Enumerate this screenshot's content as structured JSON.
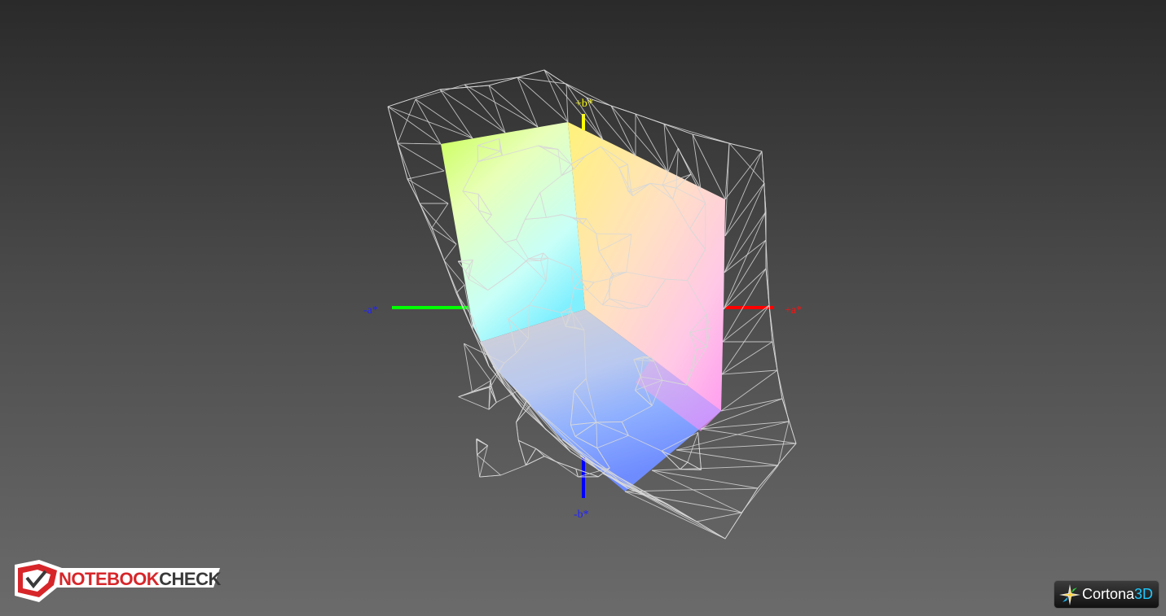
{
  "axes": {
    "plus_b": "+b*",
    "minus_b": "-b*",
    "minus_a": "-a*",
    "plus_a": "+a*"
  },
  "colors": {
    "background_top": "#2a2a2a",
    "background_bottom": "#6b6b6b",
    "axis_plus_a": "#ff0000",
    "axis_minus_a": "#00ff00",
    "axis_minus_b": "#0000ff",
    "axis_plus_b": "#ffff00",
    "wireframe": "#d8d8d8"
  },
  "branding": {
    "left_logo_part1": "NOTEBOOK",
    "left_logo_part2": "CHECK",
    "right_logo_part1": "Cortona",
    "right_logo_part2": "3D"
  }
}
